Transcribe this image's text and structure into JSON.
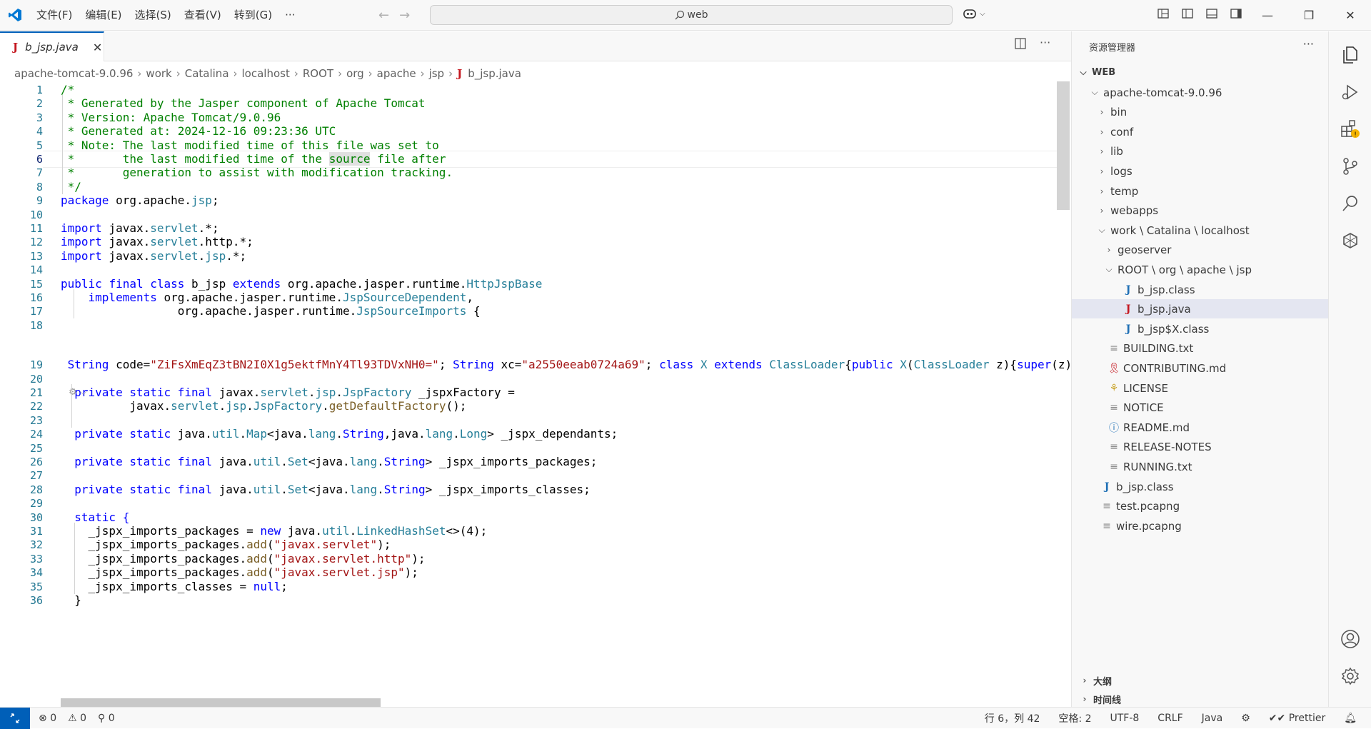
{
  "titlebar": {
    "menu": [
      "文件(F)",
      "编辑(E)",
      "选择(S)",
      "查看(V)",
      "转到(G)",
      "···"
    ],
    "search_text": "web"
  },
  "tab": {
    "icon": "J",
    "label": "b_jsp.java",
    "close": "✕"
  },
  "breadcrumb": [
    "apache-tomcat-9.0.96",
    "work",
    "Catalina",
    "localhost",
    "ROOT",
    "org",
    "apache",
    "jsp"
  ],
  "breadcrumb_file": "b_jsp.java",
  "editor": {
    "line_numbers": [
      "1",
      "2",
      "3",
      "4",
      "5",
      "6",
      "7",
      "8",
      "9",
      "10",
      "11",
      "12",
      "13",
      "14",
      "15",
      "16",
      "17",
      "18",
      "19",
      "20",
      "21",
      "22",
      "23",
      "24",
      "25",
      "26",
      "27",
      "28",
      "29",
      "30",
      "31",
      "32",
      "33",
      "34",
      "35",
      "36"
    ],
    "active_line": "6",
    "lines": [
      "/*",
      " * Generated by the Jasper component of Apache Tomcat",
      " * Version: Apache Tomcat/9.0.96",
      " * Generated at: 2024-12-16 09:23:36 UTC",
      " * Note: The last modified time of this file was set to",
      " *       the last modified time of the source file after",
      " *       generation to assist with modification tracking.",
      " */",
      "package org.apache.jsp;",
      "",
      "import javax.servlet.*;",
      "import javax.servlet.http.*;",
      "import javax.servlet.jsp.*;",
      "",
      "public final class b_jsp extends org.apache.jasper.runtime.HttpJspBase",
      "    implements org.apache.jasper.runtime.JspSourceDependent,",
      "                 org.apache.jasper.runtime.JspSourceImports {",
      "",
      " String code=\"ZiFsXmEqZ3tBN2I0X1g5ektfMnY4Tl93TDVxNH0=\"; String xc=\"a2550eeab0724a69\"; class X extends ClassLoader{public X(ClassLoader z){super(z)",
      "",
      "  private static final javax.servlet.jsp.JspFactory _jspxFactory =",
      "          javax.servlet.jsp.JspFactory.getDefaultFactory();",
      "",
      "  private static java.util.Map<java.lang.String,java.lang.Long> _jspx_dependants;",
      "",
      "  private static final java.util.Set<java.lang.String> _jspx_imports_packages;",
      "",
      "  private static final java.util.Set<java.lang.String> _jspx_imports_classes;",
      "",
      "  static {",
      "    _jspx_imports_packages = new java.util.LinkedHashSet<>(4);",
      "    _jspx_imports_packages.add(\"javax.servlet\");",
      "    _jspx_imports_packages.add(\"javax.servlet.http\");",
      "    _jspx_imports_packages.add(\"javax.servlet.jsp\");",
      "    _jspx_imports_classes = null;",
      "  }"
    ]
  },
  "explorer": {
    "title": "资源管理器",
    "more": "···",
    "root": "WEB",
    "items": [
      {
        "label": "apache-tomcat-9.0.96",
        "type": "folder-open"
      },
      {
        "label": "bin",
        "type": "folder"
      },
      {
        "label": "conf",
        "type": "folder"
      },
      {
        "label": "lib",
        "type": "folder"
      },
      {
        "label": "logs",
        "type": "folder"
      },
      {
        "label": "temp",
        "type": "folder"
      },
      {
        "label": "webapps",
        "type": "folder"
      },
      {
        "label": "work \\ Catalina \\ localhost",
        "type": "folder-open"
      },
      {
        "label": "geoserver",
        "type": "folder"
      },
      {
        "label": "ROOT \\ org \\ apache \\ jsp",
        "type": "folder-open"
      },
      {
        "label": "b_jsp.class",
        "type": "java-blue"
      },
      {
        "label": "b_jsp.java",
        "type": "java-red"
      },
      {
        "label": "b_jsp$X.class",
        "type": "java-blue"
      },
      {
        "label": "BUILDING.txt",
        "type": "text"
      },
      {
        "label": "CONTRIBUTING.md",
        "type": "ribbon"
      },
      {
        "label": "LICENSE",
        "type": "license"
      },
      {
        "label": "NOTICE",
        "type": "text"
      },
      {
        "label": "README.md",
        "type": "info"
      },
      {
        "label": "RELEASE-NOTES",
        "type": "text"
      },
      {
        "label": "RUNNING.txt",
        "type": "text"
      },
      {
        "label": "b_jsp.class",
        "type": "java-blue"
      },
      {
        "label": "test.pcapng",
        "type": "text"
      },
      {
        "label": "wire.pcapng",
        "type": "text"
      }
    ],
    "outline": "大纲",
    "timeline": "时间线"
  },
  "statusbar": {
    "errors": "0",
    "warnings": "0",
    "ports": "0",
    "position": "行 6，列 42",
    "spaces": "空格: 2",
    "encoding": "UTF-8",
    "eol": "CRLF",
    "language": "Java",
    "prettier": "Prettier"
  }
}
